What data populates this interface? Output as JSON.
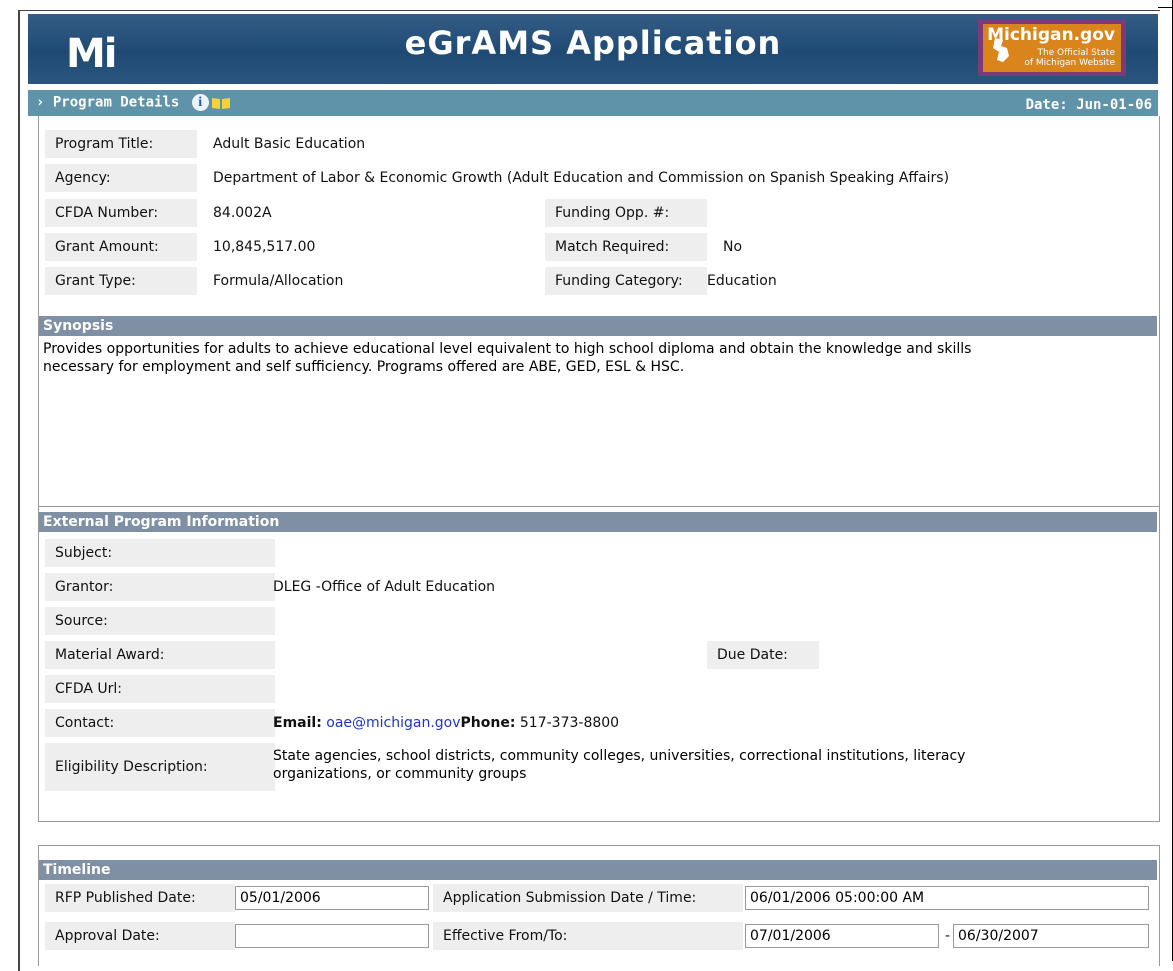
{
  "header": {
    "title": "eGrAMS Application",
    "logo_text": "Mi",
    "mi_gov_title": "Michigan.gov",
    "mi_gov_sub1": "The Official State",
    "mi_gov_sub2": "of Michigan Website"
  },
  "bar": {
    "label": "Program Details",
    "date": "Date: Jun-01-06"
  },
  "details": {
    "program_title_label": "Program Title:",
    "program_title": "Adult Basic Education",
    "agency_label": "Agency:",
    "agency": "Department of Labor & Economic Growth (Adult Education and Commission on Spanish Speaking Affairs)",
    "cfda_label": "CFDA Number:",
    "cfda": "84.002A",
    "funding_opp_label": "Funding Opp. #:",
    "funding_opp": "",
    "grant_amount_label": "Grant Amount:",
    "grant_amount": "10,845,517.00",
    "match_label": "Match Required:",
    "match": "No",
    "grant_type_label": "Grant Type:",
    "grant_type": "Formula/Allocation",
    "funding_cat_label": "Funding Category:",
    "funding_cat": "Education"
  },
  "synopsis": {
    "heading": "Synopsis",
    "line1": "Provides opportunities for adults to achieve educational level equivalent to high school diploma and obtain the knowledge and skills",
    "line2": "necessary for employment and self sufficiency. Programs offered are ABE, GED, ESL & HSC."
  },
  "external": {
    "heading": "External Program Information",
    "subject_label": "Subject:",
    "subject": "",
    "grantor_label": "Grantor:",
    "grantor": "DLEG -Office of Adult Education",
    "source_label": "Source:",
    "source": "",
    "material_label": "Material Award:",
    "due_label": "Due Date:",
    "cfda_url_label": "CFDA Url:",
    "contact_label": "Contact:",
    "email_label": "Email:",
    "email": "oae@michigan.gov",
    "phone_label": "Phone:",
    "phone": "517-373-8800",
    "elig_label": "Eligibility Description:",
    "elig_line1": "State agencies, school districts, community colleges, universities, correctional institutions, literacy",
    "elig_line2": "organizations, or community groups"
  },
  "timeline": {
    "heading": "Timeline",
    "rfp_label": "RFP Published Date:",
    "rfp": "05/01/2006",
    "submission_label": "Application Submission Date / Time:",
    "submission": "06/01/2006 05:00:00 AM",
    "approval_label": "Approval Date:",
    "approval": "",
    "effective_label": "Effective From/To:",
    "from": "07/01/2006",
    "dash": "-",
    "to": "06/30/2007"
  }
}
